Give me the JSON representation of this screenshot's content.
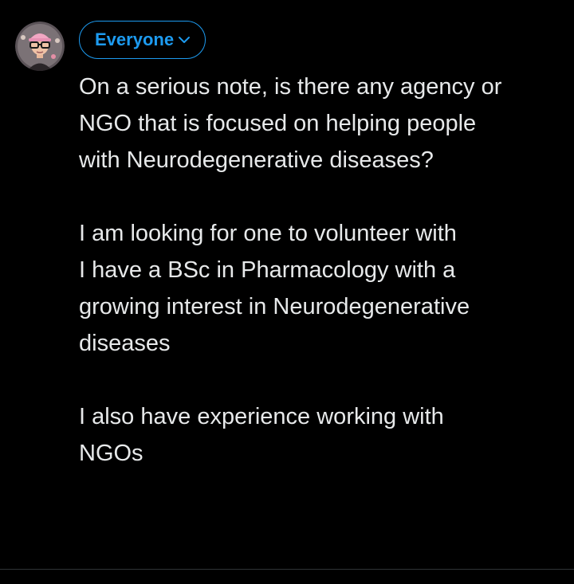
{
  "audience": {
    "label": "Everyone",
    "color": "#1d9bf0"
  },
  "avatar": {
    "icon": "user-avatar-icon",
    "hat_color": "#f2a7c3",
    "face_color": "#efc2a6"
  },
  "post": {
    "text": "On a serious note, is there any agency or\nNGO that is focused on helping people\nwith Neurodegenerative diseases?\n\nI am looking for one to volunteer with\nI have a BSc in Pharmacology with a\ngrowing interest in Neurodegenerative\ndiseases\n\nI also have experience working with\nNGOs"
  },
  "colors": {
    "background": "#000000",
    "text": "#e7e9ea",
    "divider": "#2f3336"
  }
}
